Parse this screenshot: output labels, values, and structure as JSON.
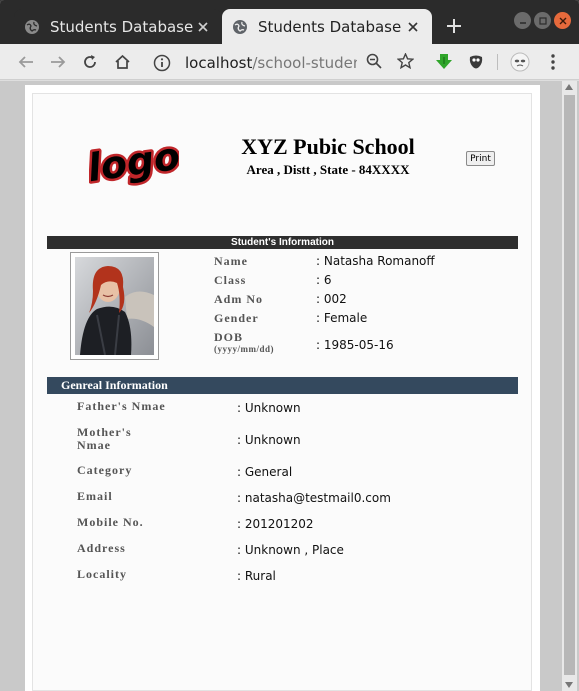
{
  "browser": {
    "tabs": [
      {
        "title": "Students Database",
        "active": false
      },
      {
        "title": "Students Database",
        "active": true
      }
    ],
    "url_host": "localhost",
    "url_path": "/school-student..."
  },
  "page": {
    "logo_text": "logo",
    "school_name": "XYZ Pubic School",
    "school_address": "Area , Distt , State - 84XXXX",
    "print_label": "Print",
    "student_section_title": "Student's Information",
    "student_fields": [
      {
        "label": "Name",
        "value": ": Natasha Romanoff"
      },
      {
        "label": "Class",
        "value": ": 6"
      },
      {
        "label": "Adm No",
        "value": ": 002"
      },
      {
        "label": "Gender",
        "value": ": Female"
      },
      {
        "label": "DOB",
        "sublabel": "(yyyy/mm/dd)",
        "value": ": 1985-05-16"
      }
    ],
    "general_section_title": "Genreal Information",
    "general_fields": [
      {
        "label": "Father's Nmae",
        "value": ": Unknown"
      },
      {
        "label": "Mother's Nmae",
        "value": ": Unknown"
      },
      {
        "label": "Category",
        "value": ": General"
      },
      {
        "label": "Email",
        "value": ": natasha@testmail0.com"
      },
      {
        "label": "Mobile No.",
        "value": ": 201201202"
      },
      {
        "label": "Address",
        "value": ": Unknown , Place"
      },
      {
        "label": "Locality",
        "value": ": Rural"
      }
    ]
  },
  "colors": {
    "dark_bar": "#2e2e2e",
    "blue_bar": "#34495e",
    "label_gray": "#555555",
    "extension_green": "#2fa52a"
  },
  "icons": [
    "globe-icon",
    "close-icon",
    "plus-icon",
    "minimize-icon",
    "maximize-icon",
    "back-icon",
    "forward-icon",
    "reload-icon",
    "home-icon",
    "info-icon",
    "zoom-icon",
    "star-icon",
    "download-extension-icon",
    "gimp-extension-icon",
    "profile-icon",
    "menu-icon"
  ]
}
